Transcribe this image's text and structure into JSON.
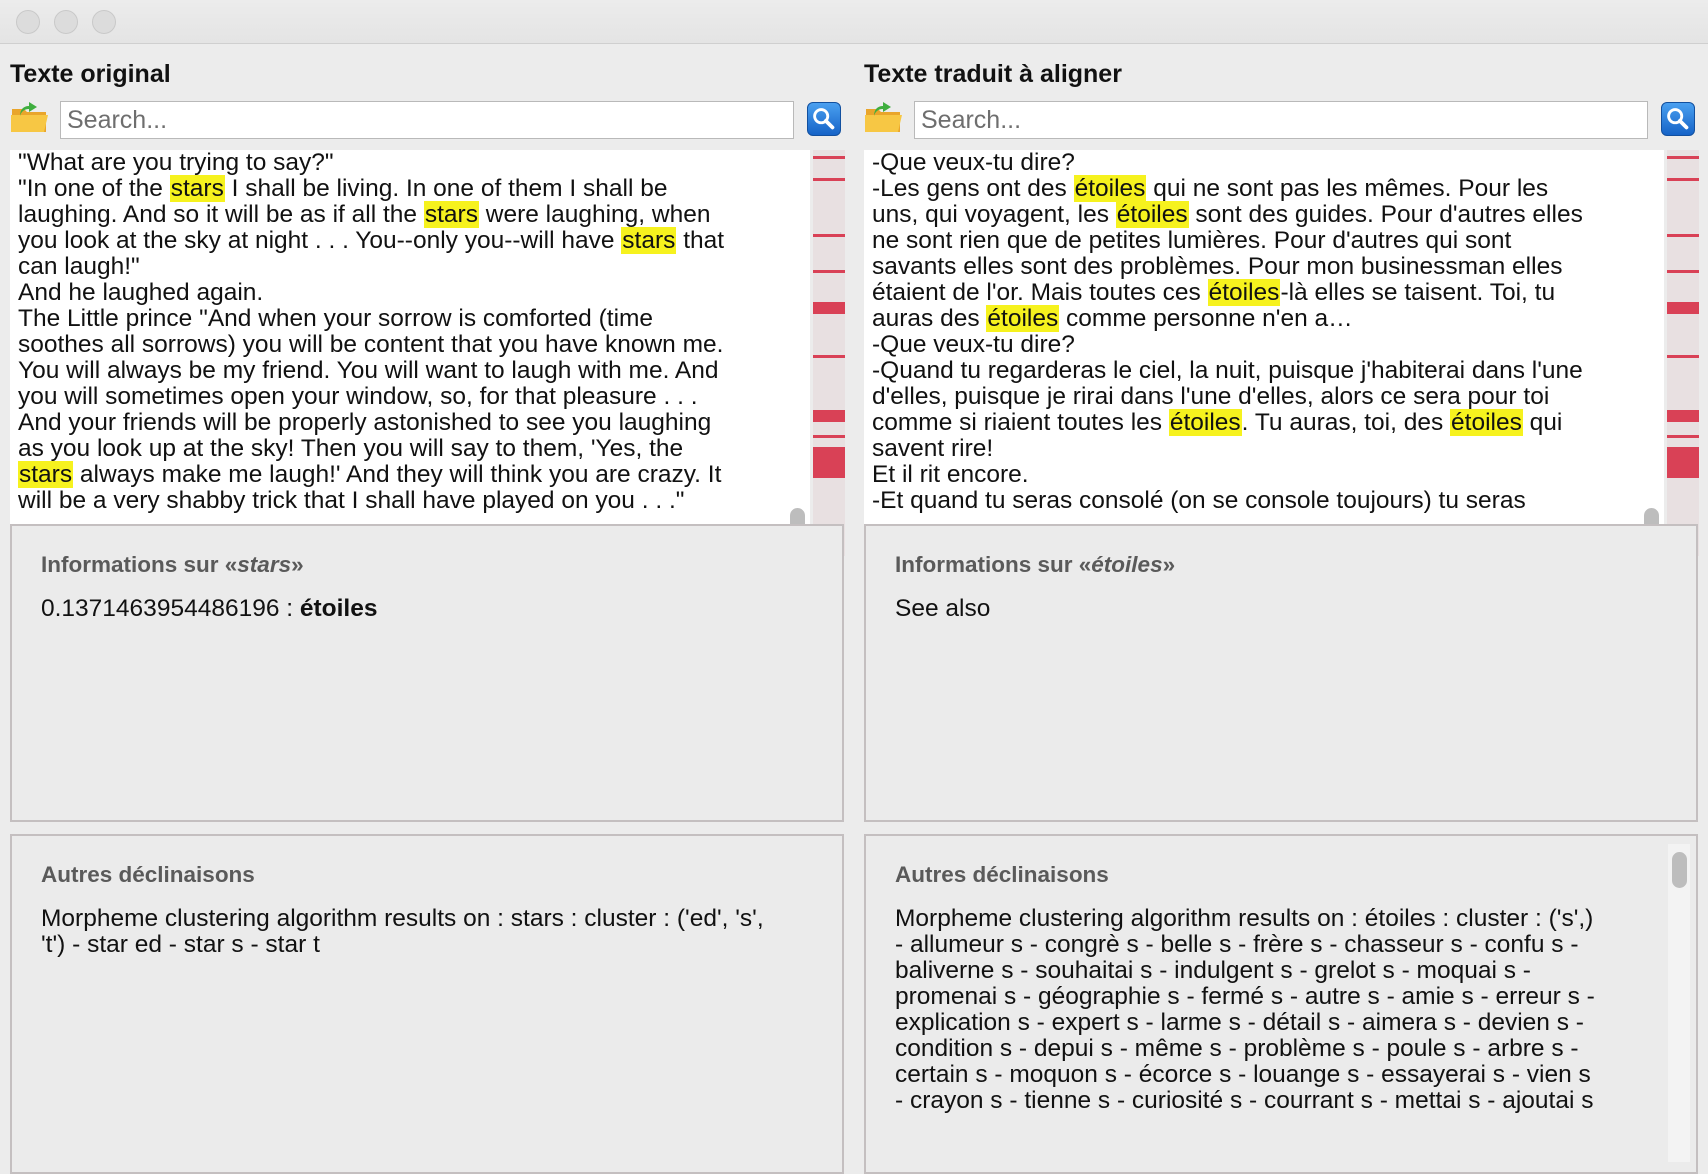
{
  "window": {
    "traffic_lights": [
      "close",
      "minimize",
      "zoom"
    ]
  },
  "left": {
    "title": "Texte original",
    "search_placeholder": "Search...",
    "text_lines": [
      [
        {
          "t": "\"What are you trying to say?\""
        }
      ],
      [
        {
          "t": "\"In one of the "
        },
        {
          "t": "stars",
          "h": true
        },
        {
          "t": " I shall be living. In one of them I shall be"
        }
      ],
      [
        {
          "t": "laughing. And so it will be as if all the "
        },
        {
          "t": "stars",
          "h": true
        },
        {
          "t": " were laughing, when"
        }
      ],
      [
        {
          "t": "you look at the sky at night . . . You--only you--will have "
        },
        {
          "t": "stars",
          "h": true
        },
        {
          "t": " that"
        }
      ],
      [
        {
          "t": "can laugh!\""
        }
      ],
      [
        {
          "t": "And he laughed again."
        }
      ],
      [
        {
          "t": "The Little prince \"And when your sorrow is comforted (time"
        }
      ],
      [
        {
          "t": "soothes all sorrows) you will be content that you have known me."
        }
      ],
      [
        {
          "t": "You will always be my friend. You will want to laugh with me. And"
        }
      ],
      [
        {
          "t": "you will sometimes open your window, so, for that pleasure . . ."
        }
      ],
      [
        {
          "t": "And your friends will be properly astonished to see you laughing"
        }
      ],
      [
        {
          "t": "as you look up at the sky! Then you will say to them, 'Yes, the"
        }
      ],
      [
        {
          "t": "stars",
          "h": true
        },
        {
          "t": " always make me laugh!' And they will think you are crazy. It"
        }
      ],
      [
        {
          "t": "will be a very shabby trick that I shall have played on you . . .\""
        }
      ]
    ],
    "info": {
      "heading_prefix": "Informations sur «",
      "heading_word": "stars",
      "heading_suffix": "»",
      "score": "0.1371463954486196 : ",
      "match": "étoiles"
    },
    "declinaisons": {
      "heading": "Autres déclinaisons",
      "lines": [
        "Morpheme clustering algorithm results on : stars : cluster : ('ed', 's',",
        "'t') - star ed - star s - star t"
      ]
    }
  },
  "right": {
    "title": "Texte traduit à aligner",
    "search_placeholder": "Search...",
    "text_lines": [
      [
        {
          "t": "-Que veux-tu dire?"
        }
      ],
      [
        {
          "t": "-Les gens ont des "
        },
        {
          "t": "étoiles",
          "h": true
        },
        {
          "t": " qui ne sont pas les mêmes. Pour les"
        }
      ],
      [
        {
          "t": "uns, qui voyagent, les "
        },
        {
          "t": "étoiles",
          "h": true
        },
        {
          "t": " sont des guides. Pour d'autres elles"
        }
      ],
      [
        {
          "t": "ne sont rien que de petites lumières. Pour d'autres qui sont"
        }
      ],
      [
        {
          "t": "savants elles sont des problèmes. Pour mon businessman elles"
        }
      ],
      [
        {
          "t": "étaient de l'or. Mais toutes ces "
        },
        {
          "t": "étoiles",
          "h": true
        },
        {
          "t": "-là elles se taisent. Toi, tu"
        }
      ],
      [
        {
          "t": "auras des "
        },
        {
          "t": "étoiles",
          "h": true
        },
        {
          "t": " comme personne n'en a…"
        }
      ],
      [
        {
          "t": "-Que veux-tu dire?"
        }
      ],
      [
        {
          "t": "-Quand tu regarderas le ciel, la nuit, puisque j'habiterai dans l'une"
        }
      ],
      [
        {
          "t": "d'elles, puisque je rirai dans l'une d'elles, alors ce sera pour toi"
        }
      ],
      [
        {
          "t": "comme si riaient toutes les "
        },
        {
          "t": "étoiles",
          "h": true
        },
        {
          "t": ". Tu auras, toi, des "
        },
        {
          "t": "étoiles",
          "h": true
        },
        {
          "t": " qui"
        }
      ],
      [
        {
          "t": "savent rire!"
        }
      ],
      [
        {
          "t": "Et il rit encore."
        }
      ],
      [
        {
          "t": "-Et quand tu seras consolé (on se console toujours) tu seras"
        }
      ]
    ],
    "info": {
      "heading_prefix": "Informations sur «",
      "heading_word": "étoiles",
      "heading_suffix": "»",
      "see_also": "See also"
    },
    "declinaisons": {
      "heading": "Autres déclinaisons",
      "lines": [
        "Morpheme clustering algorithm results on : étoiles : cluster : ('s',)",
        "- allumeur s - congrè s - belle s - frère s - chasseur s - confu s -",
        "baliverne s - souhaitai s - indulgent s - grelot s - moquai s -",
        "promenai s - géographie s - fermé s - autre s - amie s - erreur s -",
        "explication s - expert s - larme s - détail s - aimera s - devien s -",
        "condition s - depui s - même s - problème s - poule s - arbre s -",
        "certain s - moquon s - écorce s - louange s - essayerai s - vien s",
        "- crayon s - tienne s - curiosité s - courrant s - mettai s - ajoutai s"
      ]
    }
  },
  "colors": {
    "highlight": "#f6f21e",
    "marker": "#d94156",
    "marker_strip": "#e8e0e1"
  },
  "icons": {
    "open": "open-folder-icon",
    "search": "search-icon"
  }
}
